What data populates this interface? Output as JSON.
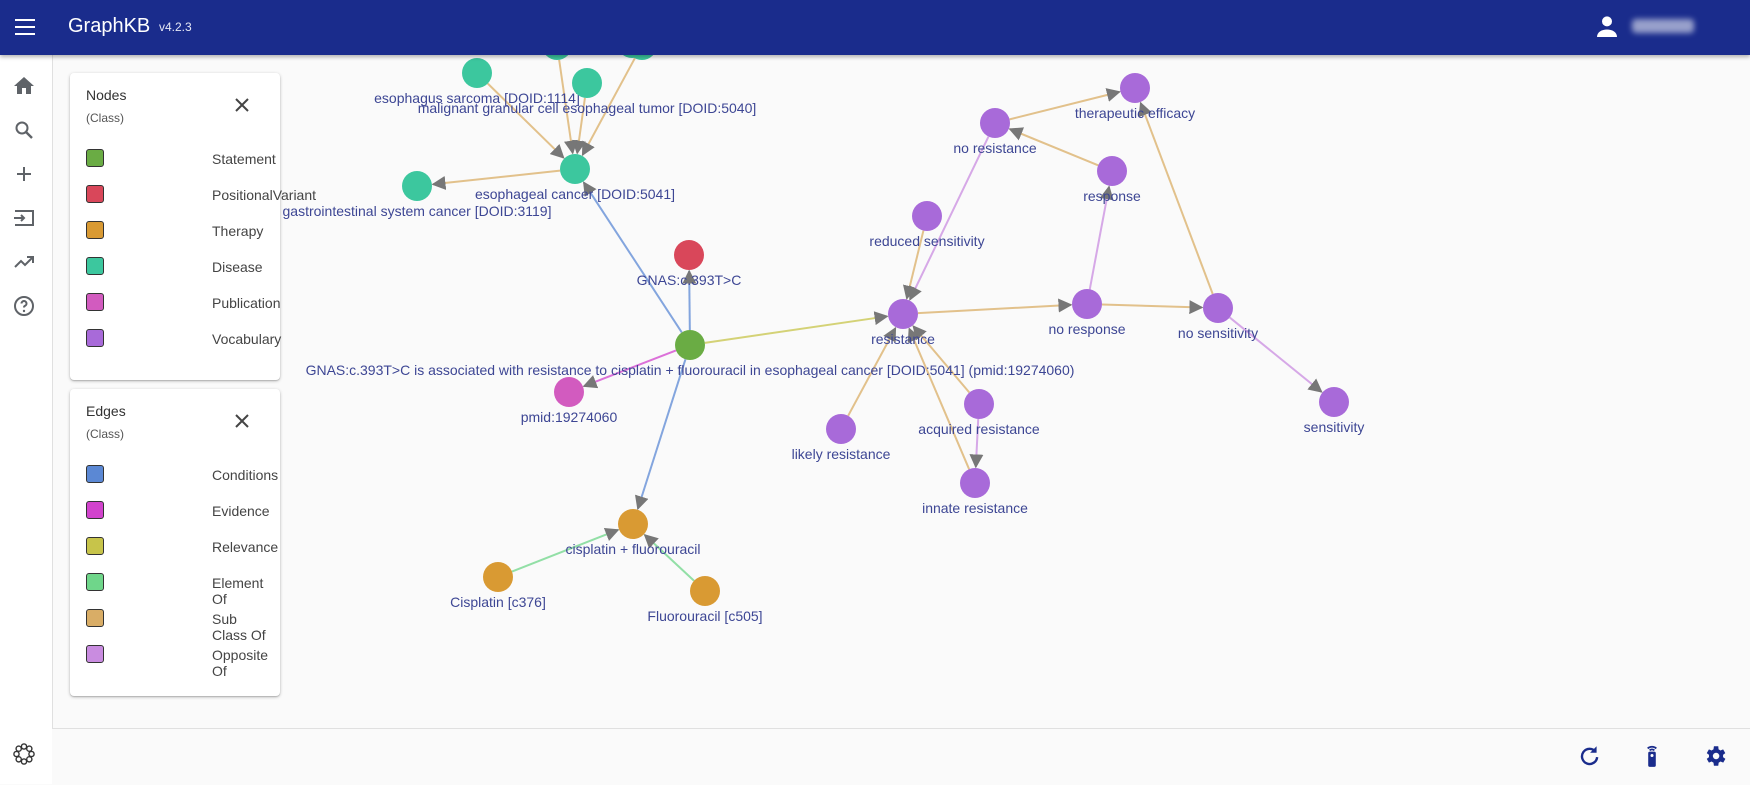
{
  "app": {
    "title": "GraphKB",
    "version": "v4.2.3"
  },
  "header": {
    "menu_icon": "menu-icon",
    "user_icon": "account-icon",
    "user_name": ""
  },
  "sidebar": {
    "items": [
      {
        "name": "home",
        "icon": "home-icon"
      },
      {
        "name": "search",
        "icon": "search-icon"
      },
      {
        "name": "add",
        "icon": "add-icon"
      },
      {
        "name": "import",
        "icon": "input-icon"
      },
      {
        "name": "activity",
        "icon": "trending-up-icon"
      },
      {
        "name": "help",
        "icon": "help-icon"
      }
    ],
    "bottom_icon": "settings-flower-icon"
  },
  "legend_nodes": {
    "title": "Nodes",
    "subtitle": "(Class)",
    "items": [
      {
        "label": "Statement",
        "color": "#6aac44"
      },
      {
        "label": "PositionalVariant",
        "color": "#d9475a"
      },
      {
        "label": "Therapy",
        "color": "#d99a33"
      },
      {
        "label": "Disease",
        "color": "#3cc79e"
      },
      {
        "label": "Publication",
        "color": "#d25bbf"
      },
      {
        "label": "Vocabulary",
        "color": "#a86ad9"
      }
    ]
  },
  "legend_edges": {
    "title": "Edges",
    "subtitle": "(Class)",
    "items": [
      {
        "label": "Conditions",
        "color": "#5b88d4"
      },
      {
        "label": "Evidence",
        "color": "#d243cd"
      },
      {
        "label": "Relevance",
        "color": "#c7c44a"
      },
      {
        "label": "Element Of",
        "color": "#6fd68a"
      },
      {
        "label": "Sub Class Of",
        "color": "#d9ad66"
      },
      {
        "label": "Opposite Of",
        "color": "#c98ce0"
      }
    ]
  },
  "graph": {
    "nodes": [
      {
        "id": "n1",
        "label": "esophagus sarcoma [DOID:1114]",
        "class": "Disease"
      },
      {
        "id": "n2",
        "label": "malignant granular cell esophageal tumor [DOID:5040]",
        "class": "Disease"
      },
      {
        "id": "n3",
        "label": "esophageal cancer [DOID:5041]",
        "class": "Disease"
      },
      {
        "id": "n4",
        "label": "gastrointestinal system cancer [DOID:3119]",
        "class": "Disease"
      },
      {
        "id": "n5",
        "label": "GNAS:c.393T>C",
        "class": "PositionalVariant"
      },
      {
        "id": "n6",
        "label": "GNAS:c.393T>C is associated with resistance to cisplatin + fluorouracil in esophageal cancer [DOID:5041] (pmid:19274060)",
        "class": "Statement"
      },
      {
        "id": "n7",
        "label": "pmid:19274060",
        "class": "Publication"
      },
      {
        "id": "n8",
        "label": "cisplatin + fluorouracil",
        "class": "Therapy"
      },
      {
        "id": "n9",
        "label": "Cisplatin [c376]",
        "class": "Therapy"
      },
      {
        "id": "n10",
        "label": "Fluorouracil [c505]",
        "class": "Therapy"
      },
      {
        "id": "n11",
        "label": "resistance",
        "class": "Vocabulary"
      },
      {
        "id": "n12",
        "label": "reduced sensitivity",
        "class": "Vocabulary"
      },
      {
        "id": "n13",
        "label": "no resistance",
        "class": "Vocabulary"
      },
      {
        "id": "n14",
        "label": "therapeutic efficacy",
        "class": "Vocabulary"
      },
      {
        "id": "n15",
        "label": "response",
        "class": "Vocabulary"
      },
      {
        "id": "n16",
        "label": "no response",
        "class": "Vocabulary"
      },
      {
        "id": "n17",
        "label": "no sensitivity",
        "class": "Vocabulary"
      },
      {
        "id": "n18",
        "label": "sensitivity",
        "class": "Vocabulary"
      },
      {
        "id": "n19",
        "label": "likely resistance",
        "class": "Vocabulary"
      },
      {
        "id": "n20",
        "label": "acquired resistance",
        "class": "Vocabulary"
      },
      {
        "id": "n21",
        "label": "innate resistance",
        "class": "Vocabulary"
      },
      {
        "id": "e_a",
        "label": "",
        "class": "Disease"
      },
      {
        "id": "e_b",
        "label": "",
        "class": "Disease"
      },
      {
        "id": "e_c",
        "label": "",
        "class": "Disease"
      }
    ],
    "edges": [
      {
        "from": "n1",
        "to": "n3",
        "class": "Sub Class Of"
      },
      {
        "from": "n2",
        "to": "n3",
        "class": "Sub Class Of"
      },
      {
        "from": "e_a",
        "to": "n3",
        "class": "Sub Class Of"
      },
      {
        "from": "e_b",
        "to": "n3",
        "class": "Sub Class Of"
      },
      {
        "from": "n3",
        "to": "n4",
        "class": "Sub Class Of"
      },
      {
        "from": "n6",
        "to": "n3",
        "class": "Conditions"
      },
      {
        "from": "n6",
        "to": "n5",
        "class": "Conditions"
      },
      {
        "from": "n6",
        "to": "n8",
        "class": "Conditions"
      },
      {
        "from": "n6",
        "to": "n7",
        "class": "Evidence"
      },
      {
        "from": "n6",
        "to": "n11",
        "class": "Relevance"
      },
      {
        "from": "n9",
        "to": "n8",
        "class": "Element Of"
      },
      {
        "from": "n10",
        "to": "n8",
        "class": "Element Of"
      },
      {
        "from": "n12",
        "to": "n11",
        "class": "Sub Class Of"
      },
      {
        "from": "n19",
        "to": "n11",
        "class": "Sub Class Of"
      },
      {
        "from": "n20",
        "to": "n11",
        "class": "Sub Class Of"
      },
      {
        "from": "n21",
        "to": "n11",
        "class": "Sub Class Of"
      },
      {
        "from": "n20",
        "to": "n21",
        "class": "Opposite Of"
      },
      {
        "from": "n13",
        "to": "n11",
        "class": "Opposite Of"
      },
      {
        "from": "n11",
        "to": "n16",
        "class": "Sub Class Of"
      },
      {
        "from": "n16",
        "to": "n17",
        "class": "Sub Class Of"
      },
      {
        "from": "n15",
        "to": "n13",
        "class": "Sub Class Of"
      },
      {
        "from": "n13",
        "to": "n14",
        "class": "Sub Class Of"
      },
      {
        "from": "n17",
        "to": "n14",
        "class": "Sub Class Of"
      },
      {
        "from": "n16",
        "to": "n15",
        "class": "Opposite Of"
      },
      {
        "from": "n17",
        "to": "n18",
        "class": "Opposite Of"
      }
    ]
  },
  "bottom": {
    "icons": [
      {
        "name": "refresh",
        "icon": "refresh-icon"
      },
      {
        "name": "remote",
        "icon": "remote-icon"
      },
      {
        "name": "settings",
        "icon": "gear-icon"
      }
    ]
  }
}
